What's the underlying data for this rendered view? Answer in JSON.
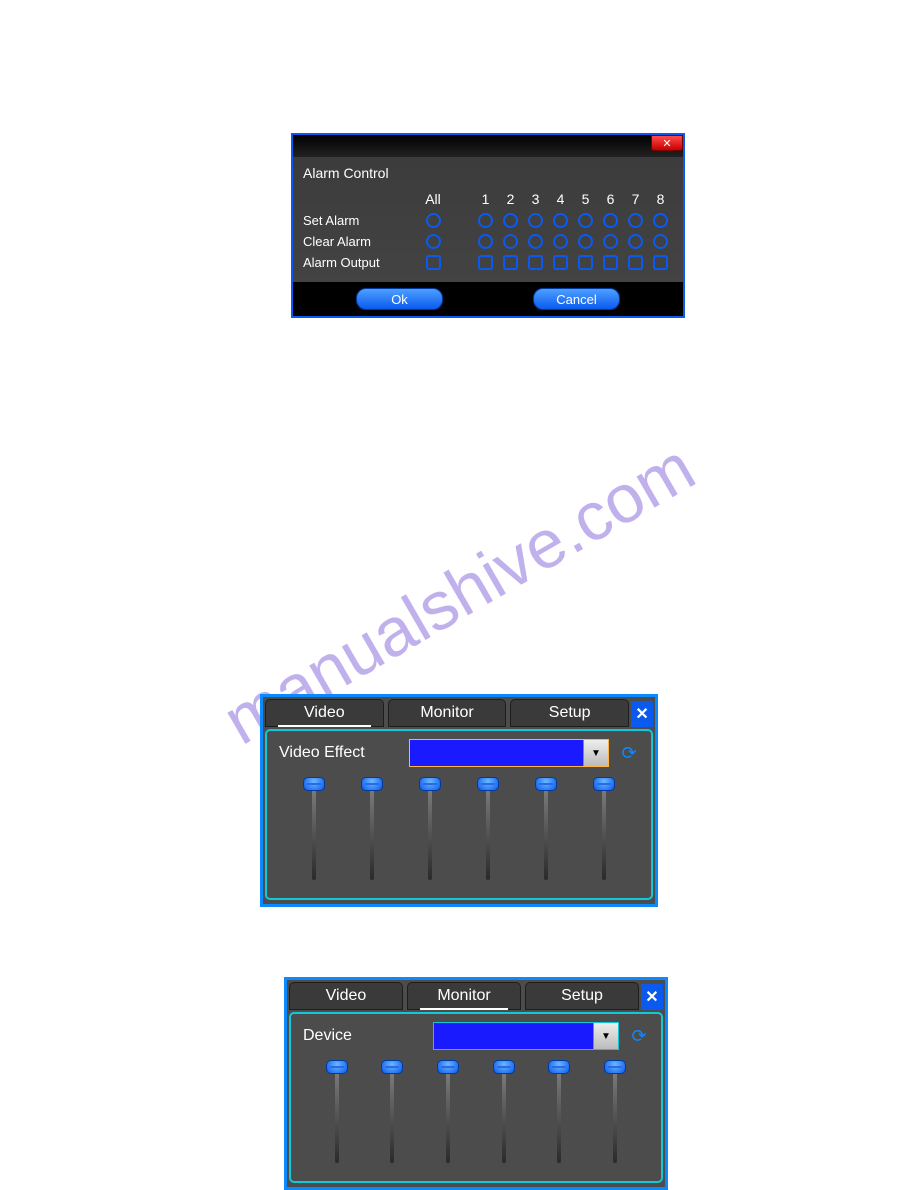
{
  "watermark": "manualshive.com",
  "alarm": {
    "title": "Alarm Control",
    "header_all": "All",
    "columns": [
      "1",
      "2",
      "3",
      "4",
      "5",
      "6",
      "7",
      "8"
    ],
    "rows": [
      {
        "label": "Set Alarm",
        "type": "radio"
      },
      {
        "label": "Clear Alarm",
        "type": "radio"
      },
      {
        "label": "Alarm Output",
        "type": "check"
      }
    ],
    "ok": "Ok",
    "cancel": "Cancel"
  },
  "panel_tabs": {
    "video": "Video",
    "monitor": "Monitor",
    "setup": "Setup"
  },
  "video_panel": {
    "label": "Video Effect",
    "combo_value": "",
    "sliders": 6
  },
  "monitor_panel": {
    "label": "Device",
    "combo_value": "",
    "sliders": 6
  }
}
